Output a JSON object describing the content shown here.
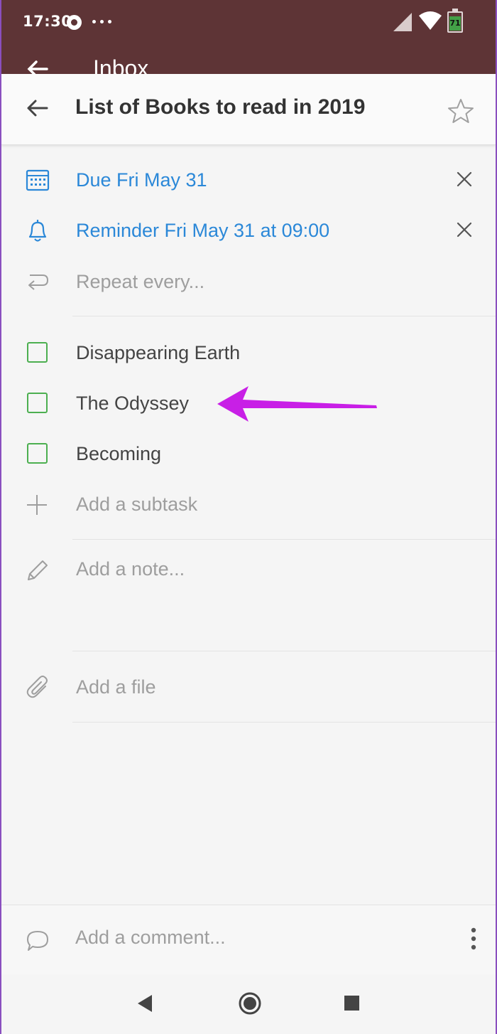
{
  "status_bar": {
    "time": "17:30",
    "battery": "71"
  },
  "background_screen": {
    "title": "Inbox"
  },
  "task": {
    "title": "List of Books to read in 2019"
  },
  "details": {
    "due": "Due Fri May 31",
    "reminder": "Reminder Fri May 31 at 09:00",
    "repeat": "Repeat every..."
  },
  "subtasks": [
    {
      "label": "Disappearing Earth",
      "checked": false
    },
    {
      "label": "The Odyssey",
      "checked": false
    },
    {
      "label": "Becoming",
      "checked": false
    }
  ],
  "add_subtask": "Add a subtask",
  "note_placeholder": "Add a note...",
  "add_file": "Add a file",
  "comment": {
    "placeholder": "Add a comment..."
  },
  "colors": {
    "status_bar": "#5e3436",
    "accent_blue": "#2b88d8",
    "checkbox_green": "#4caf50",
    "annotation_arrow": "#c81fe6"
  },
  "icons": {
    "back": "arrow-left-icon",
    "star": "star-icon",
    "due": "calendar-icon",
    "reminder": "bell-icon",
    "repeat": "repeat-icon",
    "clear": "close-icon",
    "subtask": "plus-icon",
    "note": "pencil-icon",
    "file": "paperclip-icon",
    "comment": "speech-bubble-icon",
    "more": "more-vertical-icon"
  }
}
